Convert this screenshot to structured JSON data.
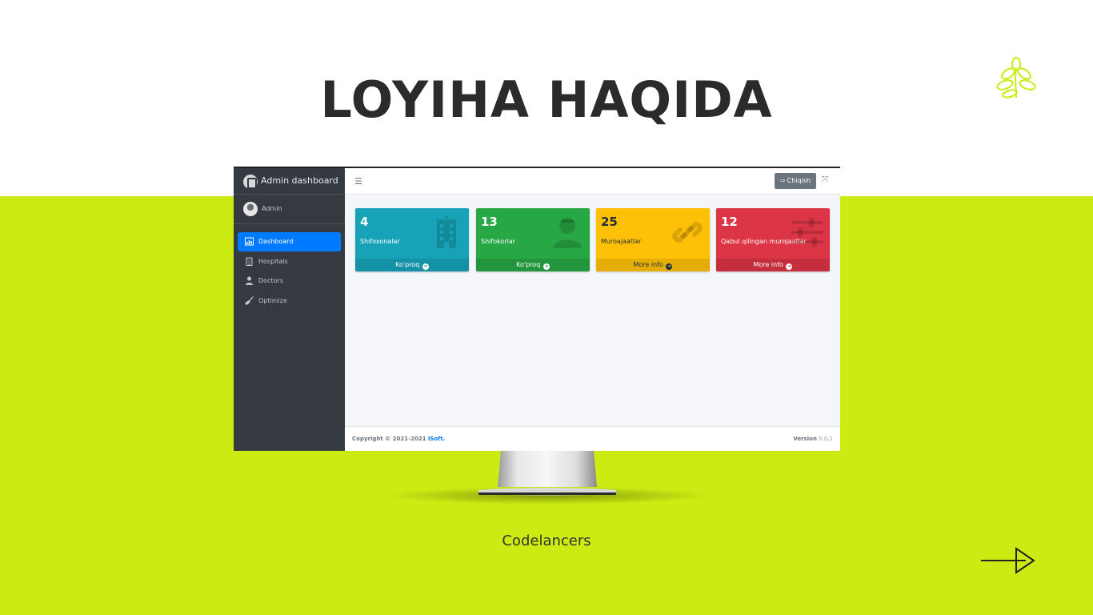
{
  "slide": {
    "title": "LOYIHA HAQIDA",
    "footer_brand": "Codelancers",
    "colors": {
      "accent": "#cbeb12",
      "title": "#2b2b2b"
    }
  },
  "admin": {
    "brand": "Admin dashboard",
    "user": "Admin",
    "nav": [
      {
        "label": "Dashboard",
        "icon": "dashboard-icon",
        "active": true
      },
      {
        "label": "Hospitals",
        "icon": "hospital-icon",
        "active": false
      },
      {
        "label": "Doctors",
        "icon": "doctor-icon",
        "active": false
      },
      {
        "label": "Optimize",
        "icon": "broom-icon",
        "active": false
      }
    ],
    "logout_label": "Chiqish",
    "cards": [
      {
        "value": "4",
        "label": "Shifoxonalar",
        "footer": "Ko'proq",
        "color": "#17a2b8",
        "icon": "hospital-icon"
      },
      {
        "value": "13",
        "label": "Shifokorlar",
        "footer": "Ko'proq",
        "color": "#28a745",
        "icon": "doctor-icon"
      },
      {
        "value": "25",
        "label": "Muroajaatlar",
        "footer": "More info",
        "color": "#ffc107",
        "icon": "link-icon"
      },
      {
        "value": "12",
        "label": "Qabul qilingan murojaatlar",
        "footer": "More info",
        "color": "#dc3545",
        "icon": "sliders-icon"
      }
    ],
    "footer": {
      "copyright": "Copyright © 2021-2021",
      "company": "iSoft.",
      "version_label": "Version",
      "version": "0.0.1"
    }
  }
}
